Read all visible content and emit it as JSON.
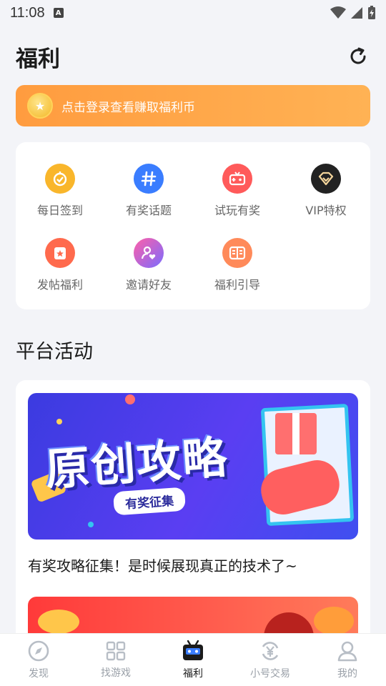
{
  "status_bar": {
    "time": "11:08",
    "app_badge": "A"
  },
  "header": {
    "title": "福利"
  },
  "login_banner": {
    "text": "点击登录查看赚取福利币"
  },
  "quick_entries": [
    {
      "label": "每日签到",
      "icon": "check-in-icon",
      "color": "#f9b62b"
    },
    {
      "label": "有奖话题",
      "icon": "hashtag-icon",
      "color": "#3a7dff"
    },
    {
      "label": "试玩有奖",
      "icon": "gamepad-icon",
      "color": "#ff5a5a"
    },
    {
      "label": "VIP特权",
      "icon": "diamond-icon",
      "color": "#222222"
    },
    {
      "label": "发帖福利",
      "icon": "post-icon",
      "color": "#ff6a4d"
    },
    {
      "label": "邀请好友",
      "icon": "invite-icon",
      "color": "#ff5fa8"
    },
    {
      "label": "福利引导",
      "icon": "guide-book-icon",
      "color": "#ff8a5a"
    }
  ],
  "section": {
    "title": "平台活动"
  },
  "activities": [
    {
      "poster_text": "原创攻略",
      "poster_subtitle": "有奖征集",
      "title": "有奖攻略征集！是时候展现真正的技术了~"
    }
  ],
  "tab_bar": [
    {
      "label": "发现",
      "icon": "compass-icon",
      "active": false
    },
    {
      "label": "找游戏",
      "icon": "grid-icon",
      "active": false
    },
    {
      "label": "福利",
      "icon": "robot-icon",
      "active": true
    },
    {
      "label": "小号交易",
      "icon": "trade-icon",
      "active": false
    },
    {
      "label": "我的",
      "icon": "person-icon",
      "active": false
    }
  ]
}
